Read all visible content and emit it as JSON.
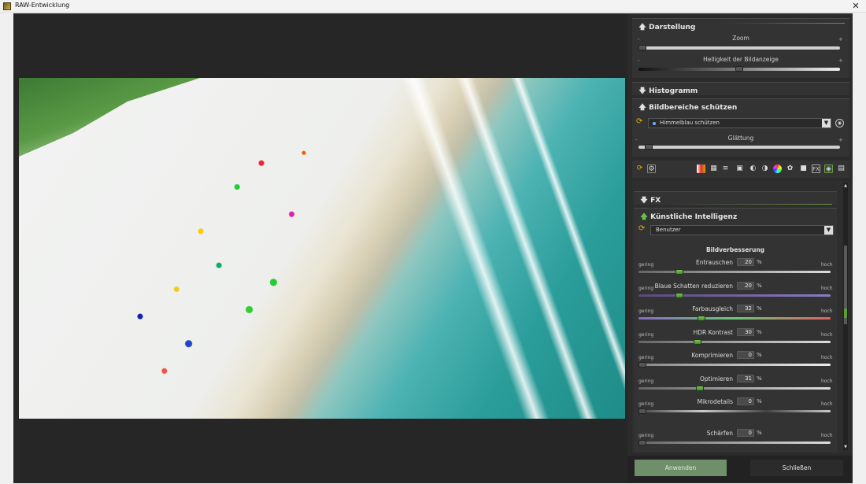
{
  "window": {
    "title": "RAW-Entwicklung",
    "close_symbol": "✕"
  },
  "darstellung": {
    "title": "Darstellung",
    "zoom_label": "Zoom",
    "brightness_label": "Helligkeit der Bildanzeige",
    "minus": "-",
    "plus": "+"
  },
  "histogramm": {
    "title": "Histogramm"
  },
  "schuetzen": {
    "title": "Bildbereiche schützen",
    "dropdown_value": "Himmelblau schützen",
    "smoothing_label": "Glättung"
  },
  "fx": {
    "title": "FX"
  },
  "ki": {
    "title": "Künstliche Intelligenz",
    "preset_value": "Benutzer",
    "subheading": "Bildverbesserung",
    "low_label": "gering",
    "high_label": "hoch",
    "pct": "%",
    "sliders": [
      {
        "name": "Entrauschen",
        "value": "20",
        "level": 0.2
      },
      {
        "name": "Blaue Schatten reduzieren",
        "value": "20",
        "level": 0.2
      },
      {
        "name": "Farbausgleich",
        "value": "32",
        "level": 0.32
      },
      {
        "name": "HDR Kontrast",
        "value": "30",
        "level": 0.3
      },
      {
        "name": "Komprimieren",
        "value": "0",
        "level": 0.0
      },
      {
        "name": "Optimieren",
        "value": "31",
        "level": 0.31
      },
      {
        "name": "Mikrodetails",
        "value": "0",
        "level": 0.0
      },
      {
        "name": "Schärfen",
        "value": "0",
        "level": 0.0
      }
    ]
  },
  "footer": {
    "apply_label": "Anwenden",
    "close_label": "Schließen"
  },
  "toolbar_icons": [
    "cycle-icon",
    "gear-icon",
    "gradient-icon",
    "levels-icon",
    "curves-icon",
    "image-icon",
    "contrast-icon",
    "tone-icon",
    "color-wheel-icon",
    "color-picker-icon",
    "camera-icon",
    "fx-icon",
    "ai-icon",
    "stack-icon"
  ],
  "colors": {
    "accent_green": "#5aa030",
    "apply_button": "#6f8f6a",
    "panel_bg": "#2b2b2b"
  }
}
